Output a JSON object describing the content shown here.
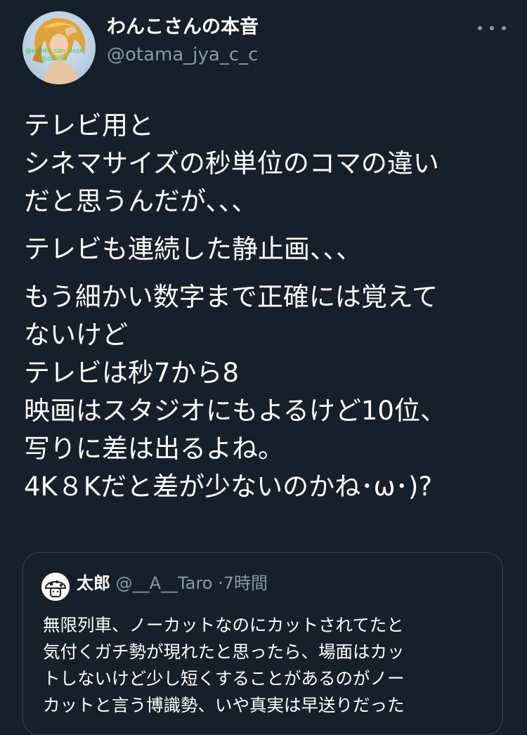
{
  "author": {
    "display_name": "わんこさんの本音",
    "handle": "@otama_jya_c_c",
    "avatar_caption_lines": [
      "@wanko.san_des4",
      "@otama"
    ]
  },
  "menu": {
    "more_icon": "more-dots-icon"
  },
  "tweet": {
    "paragraphs": [
      [
        "テレビ用と",
        "シネマサイズの秒単位のコマの違い",
        "だと思うんだが、、、"
      ],
      [
        "テレビも連続した静止画、、、"
      ],
      [
        "もう細かい数字まで正確には覚えて",
        "ないけど",
        "テレビは秒7から8",
        "映画はスタジオにもよるけど10位、",
        "写りに差は出るよね。",
        "4K８Kだと差が少ないのかね･ω･)?"
      ]
    ]
  },
  "quote": {
    "name": "太郎",
    "handle": "@__A__Taro",
    "separator": "·",
    "time": "7時間",
    "body_lines": [
      "無限列車、ノーカットなのにカットされてたと",
      "気付くガチ勢が現れたと思ったら、場面はカッ",
      "トしないけど少し短くすることがあるのがノー",
      "カットと言う博識勢、いや真実は早送りだった"
    ]
  },
  "colors": {
    "background": "#15202b",
    "text_primary": "#ffffff",
    "text_secondary": "#8899a6",
    "border": "#38444d"
  }
}
